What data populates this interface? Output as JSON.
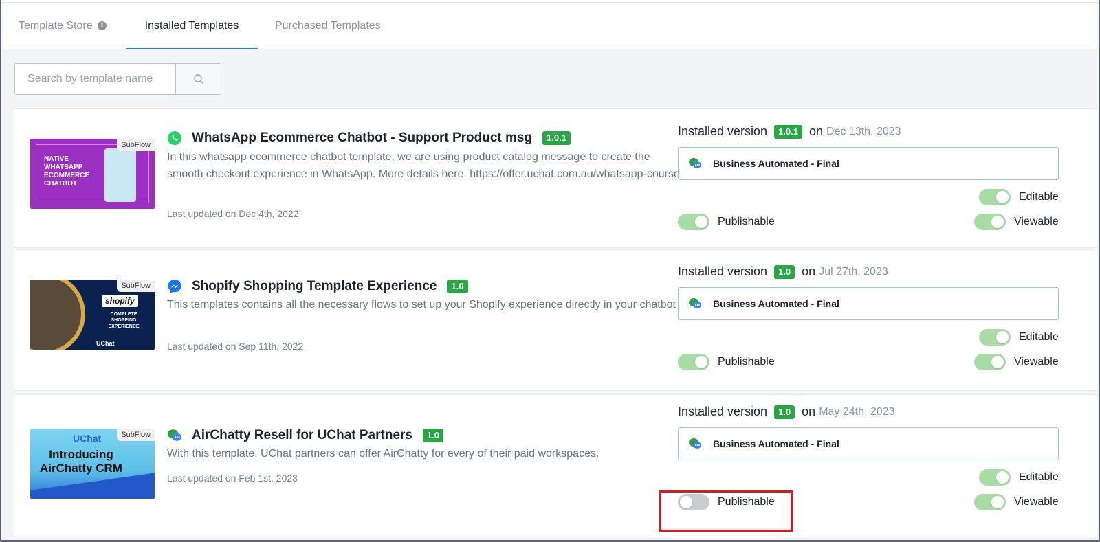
{
  "tabs": {
    "store": "Template Store",
    "installed": "Installed Templates",
    "purchased": "Purchased Templates"
  },
  "search": {
    "placeholder": "Search by template name"
  },
  "templates": [
    {
      "subflow": "SubFlow",
      "thumb_text": "NATIVE WHATSAPP ECOMMERCE CHATBOT",
      "channel_icon": "whatsapp-icon",
      "title": "WhatsApp Ecommerce Chatbot - Support Product msg",
      "version": "1.0.1",
      "description": "In this whatsapp ecommerce chatbot template, we are using product catalog message to create the smooth checkout experience in WhatsApp. More details here: https://offer.uchat.com.au/whatsapp-course",
      "updated": "Last updated on Dec 4th, 2022",
      "installed_label": "Installed version",
      "installed_version": "1.0.1",
      "on_label": "on",
      "installed_date": "Dec 13th, 2023",
      "bot": "Business Automated - Final",
      "editable_label": "Editable",
      "publishable_label": "Publishable",
      "viewable_label": "Viewable",
      "editable": true,
      "publishable": true,
      "viewable": true
    },
    {
      "subflow": "SubFlow",
      "thumb_brand": "shopify",
      "thumb_sub": "COMPLETE SHOPPING EXPERIENCE",
      "thumb_logo": "UChat",
      "channel_icon": "messenger-icon",
      "title": "Shopify Shopping Template Experience",
      "version": "1.0",
      "description": "This templates contains all the necessary flows to set up your Shopify experience directly in your chatbot",
      "updated": "Last updated on Sep 11th, 2022",
      "installed_label": "Installed version",
      "installed_version": "1.0",
      "on_label": "on",
      "installed_date": "Jul 27th, 2023",
      "bot": "Business Automated - Final",
      "editable_label": "Editable",
      "publishable_label": "Publishable",
      "viewable_label": "Viewable",
      "editable": true,
      "publishable": true,
      "viewable": true
    },
    {
      "subflow": "SubFlow",
      "thumb_logo": "UChat",
      "thumb_headline": "Introducing AirChatty CRM",
      "channel_icon": "chat-bubbles-icon",
      "title": "AirChatty Resell for UChat Partners",
      "version": "1.0",
      "description": "With this template, UChat partners can offer AirChatty for every of their paid workspaces.",
      "updated": "Last updated on Feb 1st, 2023",
      "installed_label": "Installed version",
      "installed_version": "1.0",
      "on_label": "on",
      "installed_date": "May 24th, 2023",
      "bot": "Business Automated - Final",
      "editable_label": "Editable",
      "publishable_label": "Publishable",
      "viewable_label": "Viewable",
      "editable": true,
      "publishable": false,
      "viewable": true
    }
  ],
  "colors": {
    "accent_tab": "#2b7fd6",
    "badge_green": "#28a745",
    "switch_on": "#a8dca5",
    "switch_off": "#c9ccd1",
    "highlight": "#e3151b"
  }
}
